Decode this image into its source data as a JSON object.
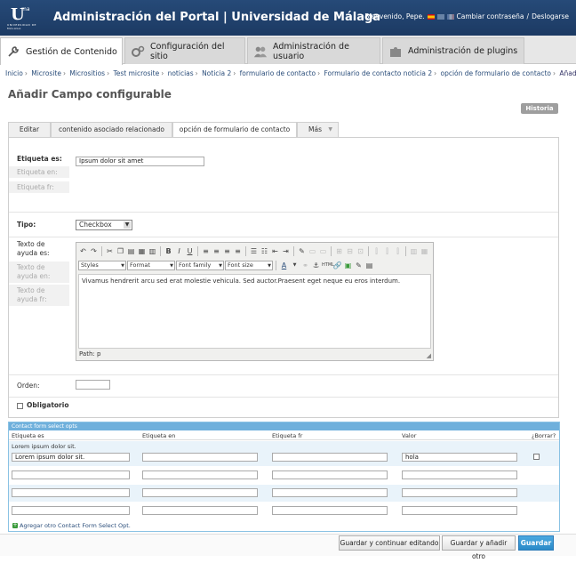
{
  "header": {
    "logo_mark": "U",
    "logo_sup": "ma",
    "logo_small": "UNIVERSIDAD DE MÁLAGA",
    "title": "Administración del Portal | Universidad de Málaga",
    "greeting": "Bienvenido, Pepe.",
    "change_password": "Cambiar contraseña",
    "separator": "/",
    "logout": "Deslogarse"
  },
  "nav": {
    "tabs": [
      {
        "label": "Gestión de Contenido",
        "icon": "wrench-icon",
        "active": true
      },
      {
        "label": "Configuración del sitio",
        "icon": "gears-icon",
        "active": false
      },
      {
        "label": "Administración de usuario",
        "icon": "users-icon",
        "active": false
      },
      {
        "label": "Administración de plugins",
        "icon": "puzzle-icon",
        "active": false
      }
    ]
  },
  "breadcrumb": [
    "Inicio",
    "Microsite",
    "Micrositios",
    "Test microsite",
    "noticias",
    "Noticia 2",
    "formulario de contacto",
    "Formulario de contacto noticia 2",
    "opción de formulario de contacto",
    "Añadir"
  ],
  "page_title": "Añadir Campo configurable",
  "history_button": "Historia",
  "form_tabs": [
    "Editar",
    "contenido asociado relacionado",
    "opción de formulario de contacto",
    "Más"
  ],
  "fields": {
    "etiqueta_es_label": "Etiqueta es:",
    "etiqueta_es_value": "Ipsum dolor sit amet",
    "etiqueta_en_label": "Etiqueta en:",
    "etiqueta_fr_label": "Etiqueta fr:",
    "tipo_label": "Tipo:",
    "tipo_value": "Checkbox",
    "texto_ayuda_es_label": "Texto de ayuda es:",
    "texto_ayuda_en_label": "Texto de ayuda en:",
    "texto_ayuda_fr_label": "Texto de ayuda fr:",
    "orden_label": "Orden:",
    "obligatorio_label": "Obligatorio"
  },
  "editor": {
    "styles": "Styles",
    "format": "Format",
    "font_family": "Font family",
    "font_size": "Font size",
    "content": "Vivamus hendrerit arcu sed erat molestie vehicula. Sed auctor.Praesent eget neque eu eros interdum.",
    "path": "Path: p"
  },
  "inline": {
    "title": "Contact form select opts",
    "columns": [
      "Etiqueta es",
      "Etiqueta en",
      "Etiqueta fr",
      "Valor",
      "¿Borrar?"
    ],
    "first_row_caption": "Lorem ipsum dolor sit.",
    "first_row": {
      "etiqueta_es": "Lorem ipsum dolor sit.",
      "valor": "hola"
    },
    "add_link": "Agregar otro Contact Form Select Opt."
  },
  "buttons": {
    "save_continue": "Guardar y continuar editando",
    "save_add": "Guardar y añadir otro",
    "save": "Guardar"
  }
}
